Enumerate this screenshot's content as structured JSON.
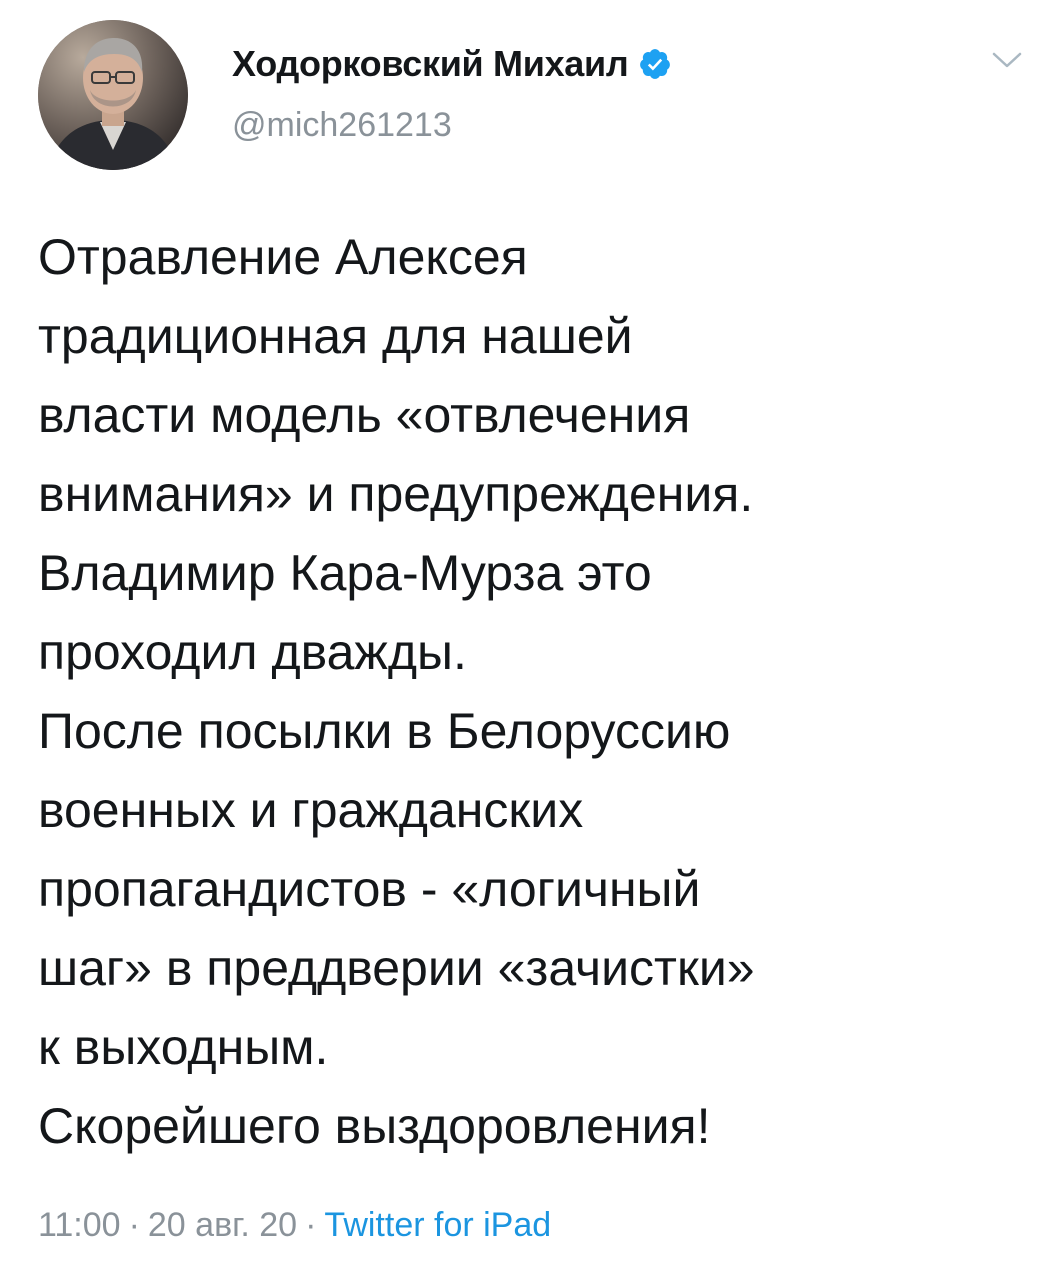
{
  "author": {
    "display_name": "Ходорковский Михаил",
    "handle": "@mich261213",
    "verified": true,
    "verified_color": "#1da1f2"
  },
  "icons": {
    "verified": "verified-badge-icon",
    "menu": "chevron-down-icon"
  },
  "tweet": {
    "lines": [
      "Отравление Алексея",
      "традиционная для нашей",
      "власти модель «отвлечения",
      "внимания» и предупреждения.",
      "Владимир Кара-Мурза это",
      "проходил дважды.",
      "После посылки в Белоруссию",
      "военных и гражданских",
      "пропагандистов - «логичный",
      "шаг» в преддверии «зачистки»",
      "к выходным.",
      "Скорейшего выздоровления!"
    ]
  },
  "meta": {
    "time": "11:00",
    "separator": "·",
    "date": "20 авг. 20",
    "source": "Twitter for iPad"
  },
  "colors": {
    "text": "#14171a",
    "muted": "#8a9299",
    "link": "#1b95e0"
  }
}
